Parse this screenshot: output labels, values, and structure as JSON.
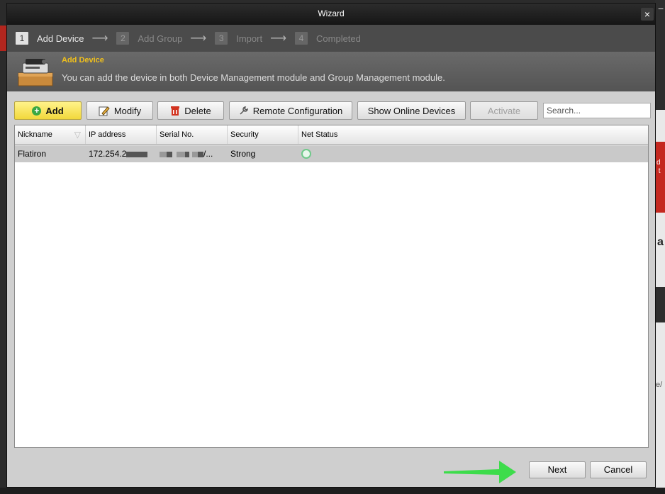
{
  "window": {
    "title": "Wizard",
    "close_glyph": "×"
  },
  "steps": [
    {
      "num": "1",
      "label": "Add Device",
      "active": true
    },
    {
      "num": "2",
      "label": "Add Group",
      "active": false
    },
    {
      "num": "3",
      "label": "Import",
      "active": false
    },
    {
      "num": "4",
      "label": "Completed",
      "active": false
    }
  ],
  "step_arrow": "⟶",
  "info": {
    "title": "Add Device",
    "text": "You can add the device in both Device Management module and Group Management module.",
    "icon": "device-box-icon"
  },
  "toolbar": {
    "add": "Add",
    "modify": "Modify",
    "delete": "Delete",
    "remote_config": "Remote Configuration",
    "show_online": "Show Online Devices",
    "activate": "Activate",
    "search_placeholder": "Search..."
  },
  "table": {
    "columns": [
      "Nickname",
      "IP address",
      "Serial No.",
      "Security",
      "Net Status"
    ],
    "rows": [
      {
        "nickname": "Flatiron",
        "ip": "172.254.2",
        "serial_suffix": "/...",
        "security": "Strong",
        "net_status": "online-icon"
      }
    ]
  },
  "footer": {
    "next": "Next",
    "cancel": "Cancel"
  },
  "background": {
    "right_text_1": "d",
    "right_text_2": "t",
    "right_letter": "a",
    "right_tail": "e/",
    "minus": "−"
  },
  "colors": {
    "accent_yellow": "#f0c01c",
    "add_button": "#f2d83c",
    "arrow_green": "#3ddc4b",
    "status_green": "#6fc98a"
  }
}
